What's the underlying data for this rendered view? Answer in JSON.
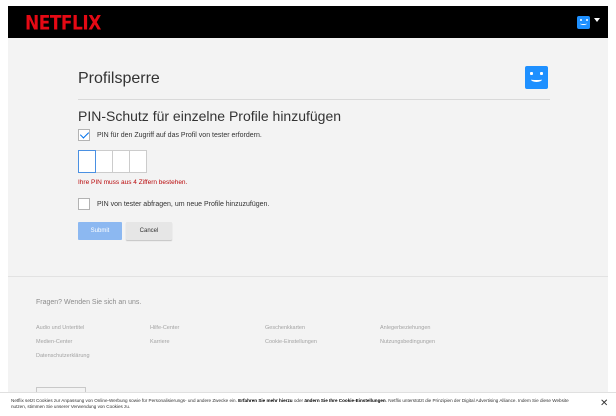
{
  "brand": {
    "logo_text": "NETFLIX",
    "logo_color": "#e50914",
    "avatar_color": "#1e90ff",
    "accent_color": "#0071eb"
  },
  "header": {
    "avatar_icon": "profile-avatar-smiley-icon",
    "menu_icon": "caret-down-icon"
  },
  "page": {
    "title": "Profilsperre",
    "subtitle": "PIN-Schutz für einzelne Profile hinzufügen",
    "require_pin": {
      "checked": true,
      "label": "PIN für den Zugriff auf das Profil von tester erfordern."
    },
    "pin": {
      "digits": [
        "",
        "",
        "",
        ""
      ]
    },
    "error_text": "Ihre PIN muss aus 4 Ziffern bestehen.",
    "error_color": "#b9090b",
    "ask_pin_new_profiles": {
      "checked": false,
      "label": "PIN von tester abfragen, um neue Profile hinzuzufügen."
    },
    "submit_label": "Submit",
    "cancel_label": "Cancel"
  },
  "footer": {
    "question": "Fragen? Wenden Sie sich an uns.",
    "links": [
      "Audio und Untertitel",
      "Hilfe-Center",
      "Geschenkkarten",
      "Anlegerbeziehungen",
      "Medien-Center",
      "Karriere",
      "Cookie-Einstellungen",
      "Nutzungsbedingungen",
      "Datenschutzerklärung"
    ]
  },
  "cookie_banner": {
    "text_1": "Netflix setzt Cookies zur Anpassung von Online-Werbung sowie für Personalisierungs- und andere Zwecke ein. ",
    "link_learn": "Erfahren Sie mehr hierzu",
    "text_2": " oder ",
    "link_settings": "ändern Sie Ihre Cookie-Einstellungen",
    "text_3": ". Netflix unterstützt die Prinzipien der Digital Advertising Alliance. Indem Sie diese Website nutzen, stimmen Sie unserer Verwendung von Cookies zu.",
    "close_glyph": "✕"
  }
}
